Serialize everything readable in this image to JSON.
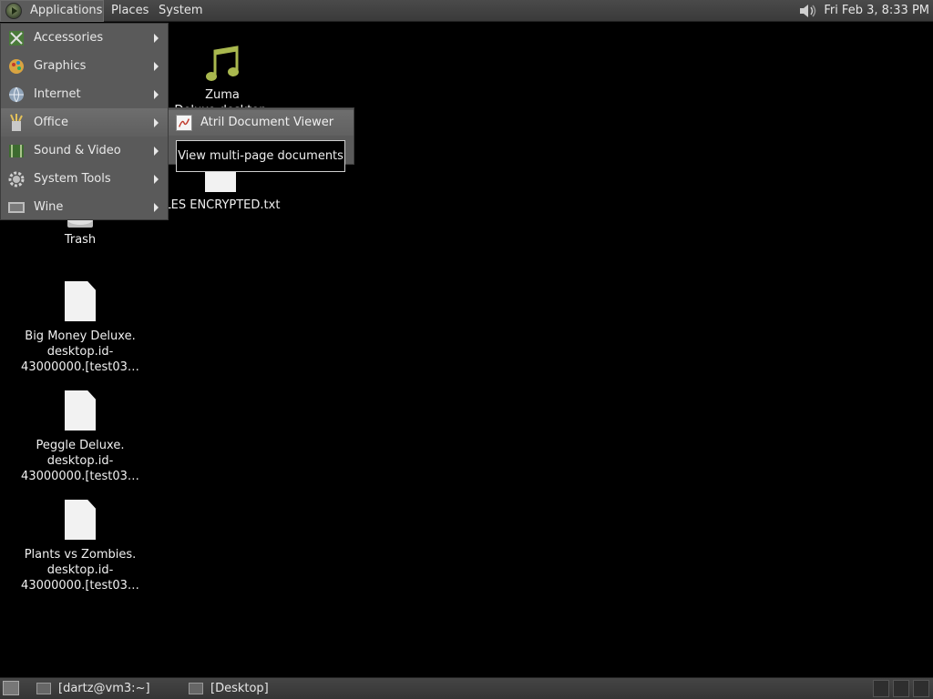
{
  "top_panel": {
    "applications_label": "Applications",
    "places_label": "Places",
    "system_label": "System",
    "volume_icon": "volume-icon",
    "clock": "Fri Feb  3,  8:33 PM"
  },
  "app_menu": {
    "items": [
      {
        "label": "Accessories",
        "icon": "accessories-icon"
      },
      {
        "label": "Graphics",
        "icon": "graphics-icon"
      },
      {
        "label": "Internet",
        "icon": "internet-icon"
      },
      {
        "label": "Office",
        "icon": "office-icon",
        "active": true
      },
      {
        "label": "Sound & Video",
        "icon": "sound-video-icon"
      },
      {
        "label": "System Tools",
        "icon": "system-tools-icon"
      },
      {
        "label": "Wine",
        "icon": "wine-icon"
      }
    ]
  },
  "office_submenu": {
    "items": [
      {
        "label": "Atril Document Viewer",
        "icon": "atril-icon"
      }
    ]
  },
  "tooltip": {
    "text": "View multi-page documents"
  },
  "desktop_icons": [
    {
      "label": "Trash",
      "icon": "trash-icon"
    },
    {
      "label": "Zuma Deluxe.desktop.",
      "icon": "music-icon"
    },
    {
      "label": "ILES ENCRYPTED.txt",
      "icon": "text-file-icon"
    },
    {
      "label_lines": [
        "Big Money Deluxe.",
        "desktop.id-",
        "43000000.[test03…"
      ],
      "icon": "file-icon"
    },
    {
      "label_lines": [
        "Peggle Deluxe.",
        "desktop.id-",
        "43000000.[test03…"
      ],
      "icon": "file-icon"
    },
    {
      "label_lines": [
        "Plants vs Zombies.",
        "desktop.id-",
        "43000000.[test03…"
      ],
      "icon": "file-icon"
    }
  ],
  "bottom_panel": {
    "tasks": [
      {
        "label": "[dartz@vm3:~]",
        "icon": "terminal-icon"
      },
      {
        "label": "[Desktop]",
        "icon": "folder-icon"
      }
    ]
  },
  "colors": {
    "panel": "#3f3f3f",
    "menu": "#5a5a5a",
    "desktop": "#000000"
  }
}
